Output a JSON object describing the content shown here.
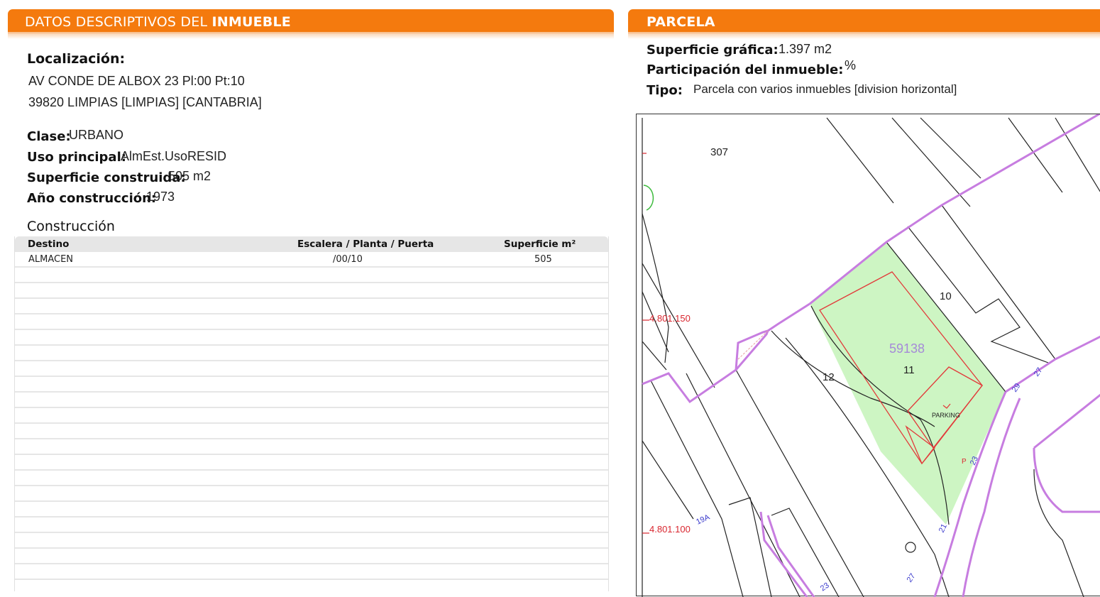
{
  "left": {
    "header_normal": "DATOS DESCRIPTIVOS DEL ",
    "header_bold": "INMUEBLE",
    "localizacion_label": "Localización:",
    "address_line1": "AV CONDE DE ALBOX 23 Pl:00 Pt:10",
    "address_line2": "39820 LIMPIAS [LIMPIAS] [CANTABRIA]",
    "clase_label": "Clase:",
    "clase_value": "URBANO",
    "uso_label": "Uso principal:",
    "uso_value": "AlmEst.UsoRESID",
    "superficie_label": "Superficie construida:",
    "superficie_value": "505 m2",
    "anio_label": "Año construcción:",
    "anio_value": "1973",
    "construccion_title": "Construcción",
    "table": {
      "columns": [
        "Destino",
        "Escalera / Planta / Puerta",
        "Superficie m²"
      ],
      "rows": [
        {
          "destino": "ALMACEN",
          "escalera": "/00/10",
          "superficie": "505"
        }
      ]
    }
  },
  "right": {
    "header": "PARCELA",
    "sup_grafica_label": "Superficie gráfica:",
    "sup_grafica_value": "1.397 m2",
    "participacion_label": "Participación del inmueble:",
    "participacion_value": "%",
    "tipo_label": "Tipo:",
    "tipo_value": "Parcela con varios inmuebles [division horizontal]",
    "map": {
      "parcel_ref": "59138",
      "labels": {
        "n307": "307",
        "n10": "10",
        "n11": "11",
        "n12": "12",
        "parking": "PARKING",
        "coord1": "4.801.150",
        "coord2": "4.801.100",
        "n19a": "19A",
        "n29": "29",
        "n27a": "27",
        "n23": "23",
        "n21": "21",
        "n27b": "27",
        "n23b": "23",
        "p": "P"
      },
      "colors": {
        "parcel_fill": "#cdf5c3",
        "boundary": "#c77de0",
        "building": "#e23a3a",
        "coords": "#d9262f",
        "numbers": "#3a3acc"
      }
    }
  }
}
